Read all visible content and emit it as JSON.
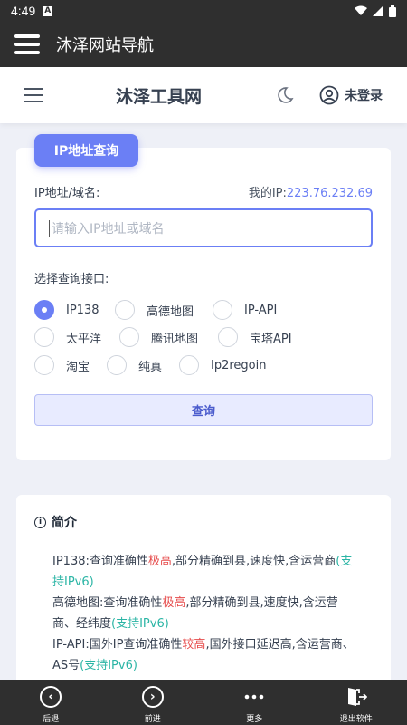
{
  "statusbar": {
    "time": "4:49",
    "notif": "A"
  },
  "appbar": {
    "title": "沐泽网站导航"
  },
  "header": {
    "brand": "沐泽工具网",
    "login": "未登录"
  },
  "query": {
    "badge": "IP地址查询",
    "label": "IP地址/域名:",
    "myip_label": "我的IP:",
    "myip_value": "223.76.232.69",
    "placeholder": "请输入IP地址或域名",
    "api_label": "选择查询接口:",
    "options": [
      "IP138",
      "高德地图",
      "IP-API",
      "太平洋",
      "腾讯地图",
      "宝塔API",
      "淘宝",
      "纯真",
      "Ip2regoin"
    ],
    "selected": "IP138",
    "submit": "查询"
  },
  "intro": {
    "title": "简介",
    "l1a": "IP138:查询准确性",
    "l1b": "极高",
    "l1c": ",部分精确到县,速度快,含运营商",
    "l1d": "(支持IPv6)",
    "l2a": "高德地图:查询准确性",
    "l2b": "极高",
    "l2c": ",部分精确到县,速度快,含运营商、经纬度",
    "l2d": "(支持IPv6)",
    "l3a": "IP-API:国外IP查询准确性",
    "l3b": "较高",
    "l3c": ",国外接口延迟高,含运营商、AS号",
    "l3d": "(支持IPv6)"
  },
  "bottomnav": {
    "back": "后退",
    "forward": "前进",
    "more": "更多",
    "exit": "退出软件"
  },
  "colors": {
    "accent": "#6b7ff5",
    "dark": "#2f2f2f",
    "red": "#e64b4b",
    "green": "#2bb5a5"
  }
}
